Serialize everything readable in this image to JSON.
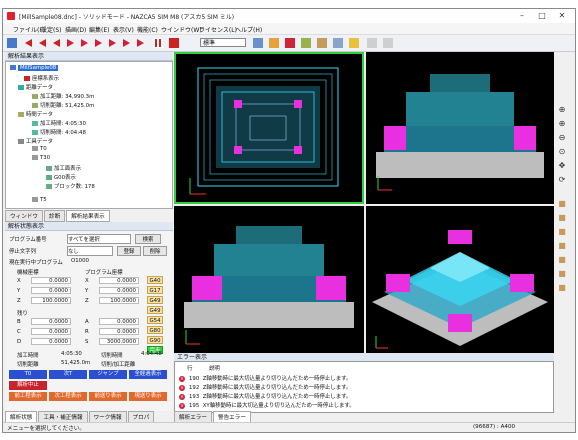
{
  "window": {
    "title": "[MillSample08.dnc] - ソリッドモード - NAZCA5 SIM M8 (アスカ5 SIM ミル)"
  },
  "menu": [
    "ファイル(F)",
    "設定(S)",
    "描画(D)",
    "編集(E)",
    "表示(V)",
    "機能(C)",
    "ウインドウ(W)",
    "ライセンス(L)",
    "ヘルプ(H)"
  ],
  "toolbar": {
    "combo": "標準"
  },
  "tree_panel": {
    "title": "解析結果表示",
    "items": [
      "MillSample08",
      "座標系表示",
      "距離データ",
      "加工距離: 34,990.3m",
      "切削距離: 51,425.0m",
      "時間データ",
      "加工時間: 4:05:30",
      "切削時間: 4:04:48",
      "工具データ",
      "T0",
      "T30",
      "加工面表示",
      "G00表示",
      "ブロック数: 178",
      "T5"
    ],
    "tabs": [
      "ウィンドウ",
      "診断",
      "解析結果表示"
    ]
  },
  "state_panel": {
    "title": "解析状態表示",
    "program_no_label": "プログラム番号",
    "program_no_value": "すべてを選択",
    "search_btn": "検索",
    "stop_label": "停止文字列",
    "stop_value": "なし",
    "register_btn": "登録",
    "delete_btn": "削除",
    "executing_label": "現在実行中プログラム",
    "executing_value": "O1000",
    "machine_coord": "機械座標",
    "program_coord": "プログラム座標",
    "axes": [
      {
        "a": "X",
        "m": "0.0000",
        "p": "0.0000",
        "g": "G40"
      },
      {
        "a": "Y",
        "m": "0.0000",
        "p": "0.0000",
        "g": "G17"
      },
      {
        "a": "Z",
        "m": "100.0000",
        "p": "100.0000",
        "g": "G49"
      }
    ],
    "g_extra": [
      "G49",
      "G54",
      "G80",
      "G90",
      "G81"
    ],
    "current_label": "残り",
    "current": [
      {
        "a": "B",
        "m": "0.0000",
        "b": "A",
        "v": "0.0000"
      },
      {
        "a": "C",
        "m": "0.0000",
        "b": "R",
        "v": "0.0000"
      },
      {
        "a": "D",
        "m": "0.0000",
        "b": "S",
        "v": "3000.0000"
      }
    ],
    "finish_btn": "完走",
    "proc_time_label": "加工時間",
    "proc_time": "4:05:30",
    "cut_time_label": "切削時間",
    "cut_time": "4:04:48",
    "cut_dist_label": "切削距離",
    "cut_dist": "51,425.0m",
    "rapid_dist_label": "切削/加工距離",
    "buttons_blue": [
      "T0",
      "次T",
      "ジャンプ",
      "全経過表示"
    ],
    "buttons_red": [
      "解析中止"
    ],
    "buttons_orange": [
      "前工程表示",
      "次工程表示",
      "前送り表示",
      "現送り表示"
    ],
    "tabs": [
      "解析状態",
      "工具・補正情報",
      "ワーク情報",
      "プロパ"
    ]
  },
  "error_panel": {
    "title": "エラー表示",
    "col_row": "行",
    "col_desc": "説明",
    "rows": [
      {
        "line": "190",
        "msg": "Z軸移動時に最大切込量より切り込んだため一時停止します。"
      },
      {
        "line": "192",
        "msg": "Z軸移動時に最大切込量より切り込んだため一時停止します。"
      },
      {
        "line": "193",
        "msg": "Z軸移動時に最大切込量より切り込んだため一時停止します。"
      },
      {
        "line": "195",
        "msg": "XY軸移動時に最大切込量より切り込んだため一時停止します。"
      }
    ],
    "tabs": [
      "解析エラー",
      "警告エラー"
    ]
  },
  "status": {
    "left": "メニューを選択してください。",
    "right": "(96687) : A400"
  },
  "colors": {
    "cyan": "#3ad8f4",
    "magenta": "#e830e0",
    "grey": "#bdbdbd",
    "accent_green": "#2fd23a"
  }
}
